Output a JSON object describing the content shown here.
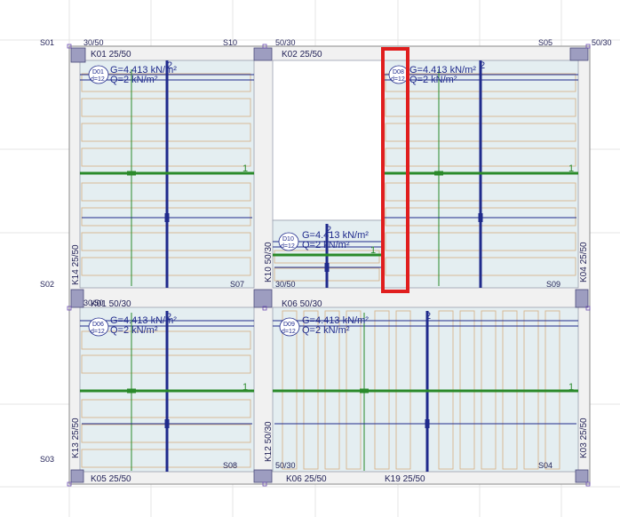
{
  "accent_colors": {
    "beam_fill": "#f1f1f1",
    "slab_fill": "#e4eef1",
    "column_fill": "#9d9dc0",
    "load_text": "#1f2a8c",
    "green_axis": "#2a8a2a",
    "joist_stroke": "#d7b48c",
    "highlight": "#e01e1e"
  },
  "columns": {
    "s01": "S01",
    "s02": "S02",
    "s03": "S03",
    "s10": "S10",
    "s07": "S07",
    "s08": "S08",
    "s05": "S05",
    "s09": "S09",
    "s04": "S04"
  },
  "column_sizes": {
    "c_tl": "30/50",
    "c_tm": "50/30",
    "c_tr": "50/30",
    "c_ml": "30/50",
    "c_mm": "30/50",
    "c_bm": "50/30"
  },
  "beams": {
    "k01_top": "K01  25/50",
    "k02": "K02   25/50",
    "k01_mid": "K01   50/30",
    "k06_mid": "K06   50/30",
    "k05": "K05   25/50",
    "k06_bot": "K06   25/50",
    "k19": "K19   25/50",
    "k14": "K14   25/50",
    "k13": "K13   25/50",
    "k10": "K10   50/30",
    "k12": "K12   50/30",
    "k04": "K04   25/50",
    "k03": "K03   25/50"
  },
  "slabs": {
    "d01": {
      "tag": "D01",
      "sub": "d=12",
      "g": "G=4.413 kN/m²",
      "q": "Q=2 kN/m²"
    },
    "d08": {
      "tag": "D08",
      "sub": "d=12",
      "g": "G=4.413 kN/m²",
      "q": "Q=2 kN/m²"
    },
    "d10": {
      "tag": "D10",
      "sub": "d=12",
      "g": "G=4.413 kN/m²",
      "q": "Q=2 kN/m²"
    },
    "d06": {
      "tag": "D06",
      "sub": "d=12",
      "g": "G=4.413 kN/m²",
      "q": "Q=2 kN/m²"
    },
    "d09": {
      "tag": "D09",
      "sub": "d=12",
      "g": "G=4.413 kN/m²",
      "q": "Q=2 kN/m²"
    }
  },
  "axis_labels": {
    "one": "1",
    "two": "2"
  }
}
